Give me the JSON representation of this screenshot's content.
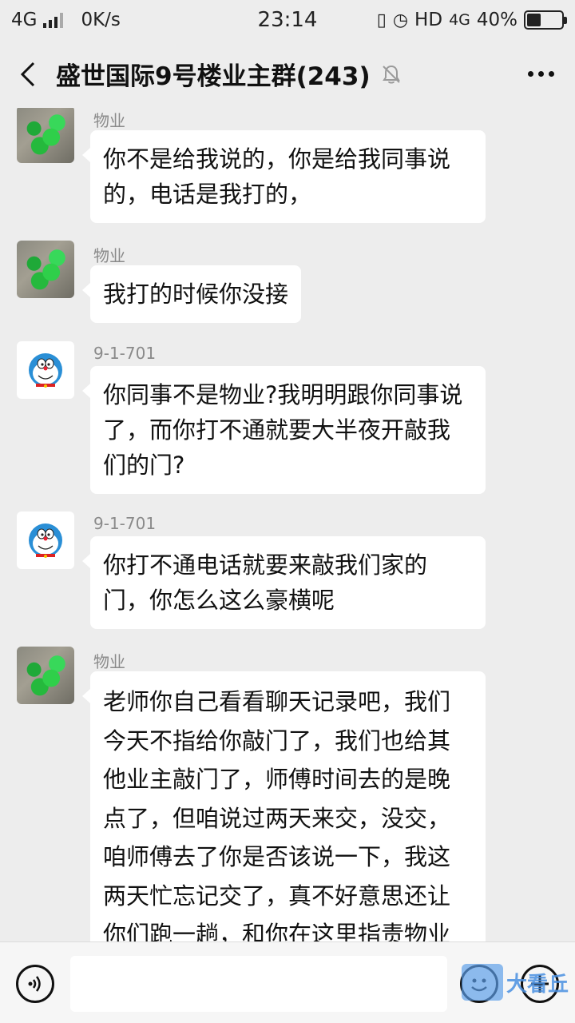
{
  "status_bar": {
    "network": "4G",
    "speed": "0K/s",
    "time": "23:14",
    "hd": "HD",
    "network2": "4G",
    "battery": "40%",
    "battery_level": 0.4
  },
  "header": {
    "title": "盛世国际9号楼业主群(243)"
  },
  "messages": [
    {
      "sender": "物业",
      "avatar": "green-crystal",
      "text": "你不是给我说的，你是给我同事说的，电话是我打的，"
    },
    {
      "sender": "物业",
      "avatar": "green-crystal",
      "text": "我打的时候你没接"
    },
    {
      "sender": "9-1-701",
      "avatar": "doraemon",
      "text": "你同事不是物业?我明明跟你同事说了，而你打不通就要大半夜开敲我们的门?"
    },
    {
      "sender": "9-1-701",
      "avatar": "doraemon",
      "text": "你打不通电话就要来敲我们家的门，你怎么这么豪横呢"
    },
    {
      "sender": "物业",
      "avatar": "green-crystal",
      "text": "老师你自己看看聊天记录吧，我们今天不指给你敲门了，我们也给其他业主敲门了，师傅时间去的是晚点了，但咱说过两天来交，没交，咱师傅去了你是否该说一下，我这两天忙忘记交了，真不好意思还让你们跑一趟，和你在这里指责物业就你问要物业费，你觉得哪个更好?"
    }
  ],
  "watermark": {
    "text": "大看丘"
  },
  "colors": {
    "background": "#ededed",
    "bubble": "#ffffff",
    "watermark": "#4a90e2"
  },
  "icons": [
    "back-icon",
    "mute-bell-icon",
    "more-icon",
    "voice-icon",
    "emoji-icon",
    "plus-icon"
  ]
}
